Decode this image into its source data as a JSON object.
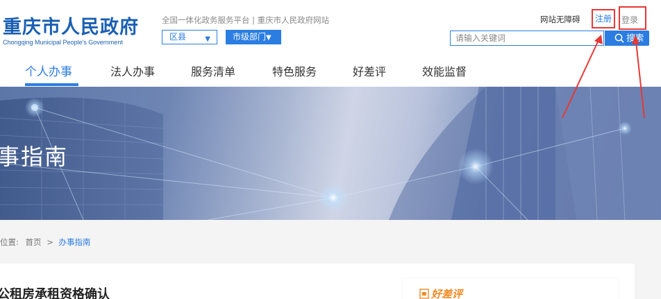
{
  "header": {
    "logo_cn": "重庆市人民政府",
    "logo_en": "Chongqing Municipal People's Government",
    "platform_text": "全国一体化政务服务平台 | 重庆市人民政府网站",
    "county_select": {
      "label": "区县",
      "caret": "▼"
    },
    "dept_select": {
      "label": "市级部门",
      "caret": "▼"
    },
    "accessibility": "网站无障碍",
    "register": "注册",
    "login": "登录",
    "search": {
      "placeholder": "请输入关键词",
      "button_label": "搜索"
    }
  },
  "nav": {
    "items": [
      {
        "label": "个人办事",
        "active": true
      },
      {
        "label": "法人办事"
      },
      {
        "label": "服务清单"
      },
      {
        "label": "特色服务"
      },
      {
        "label": "好差评"
      },
      {
        "label": "效能监督"
      }
    ]
  },
  "banner": {
    "title": "事指南"
  },
  "breadcrumb": {
    "prefix": "位置:",
    "home": "首页",
    "separator": ">",
    "current": "办事指南"
  },
  "content": {
    "item_title": "公租房承租资格确认",
    "rating_title": "好差评"
  },
  "colors": {
    "brand_blue": "#2b7de1",
    "logo_blue": "#1a5fb4",
    "annotation_red": "#e53935",
    "rating_orange": "#f08a24"
  },
  "icons": {
    "search": "search-icon",
    "rating": "rating-icon",
    "caret": "caret-down-icon"
  }
}
